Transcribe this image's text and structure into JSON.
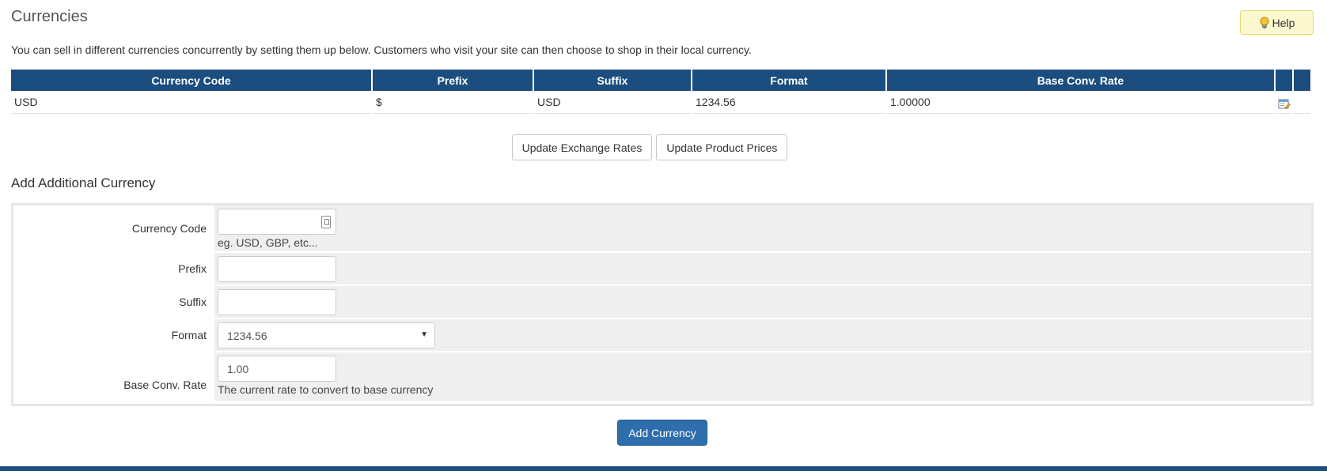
{
  "page": {
    "title": "Currencies",
    "help_label": "Help",
    "intro": "You can sell in different currencies concurrently by setting them up below. Customers who visit your site can then choose to shop in their local currency."
  },
  "table": {
    "headers": [
      "Currency Code",
      "Prefix",
      "Suffix",
      "Format",
      "Base Conv. Rate"
    ],
    "rows": [
      {
        "code": "USD",
        "prefix": "$",
        "suffix": "USD",
        "format": "1234.56",
        "rate": "1.00000",
        "action_icon": "edit-icon"
      }
    ]
  },
  "actions": {
    "update_rates": "Update Exchange Rates",
    "update_prices": "Update Product Prices"
  },
  "add_form": {
    "title": "Add Additional Currency",
    "currency_code": {
      "label": "Currency Code",
      "value": "",
      "hint": "eg. USD, GBP, etc..."
    },
    "prefix": {
      "label": "Prefix",
      "value": ""
    },
    "suffix": {
      "label": "Suffix",
      "value": ""
    },
    "format": {
      "label": "Format",
      "value": "1234.56"
    },
    "rate": {
      "label": "Base Conv. Rate",
      "value": "1.00",
      "hint": "The current rate to convert to base currency"
    },
    "submit_label": "Add Currency"
  },
  "colors": {
    "header_bg": "#1b4d7f",
    "primary_button": "#2f6ead",
    "help_bg": "#fcf8d0"
  }
}
